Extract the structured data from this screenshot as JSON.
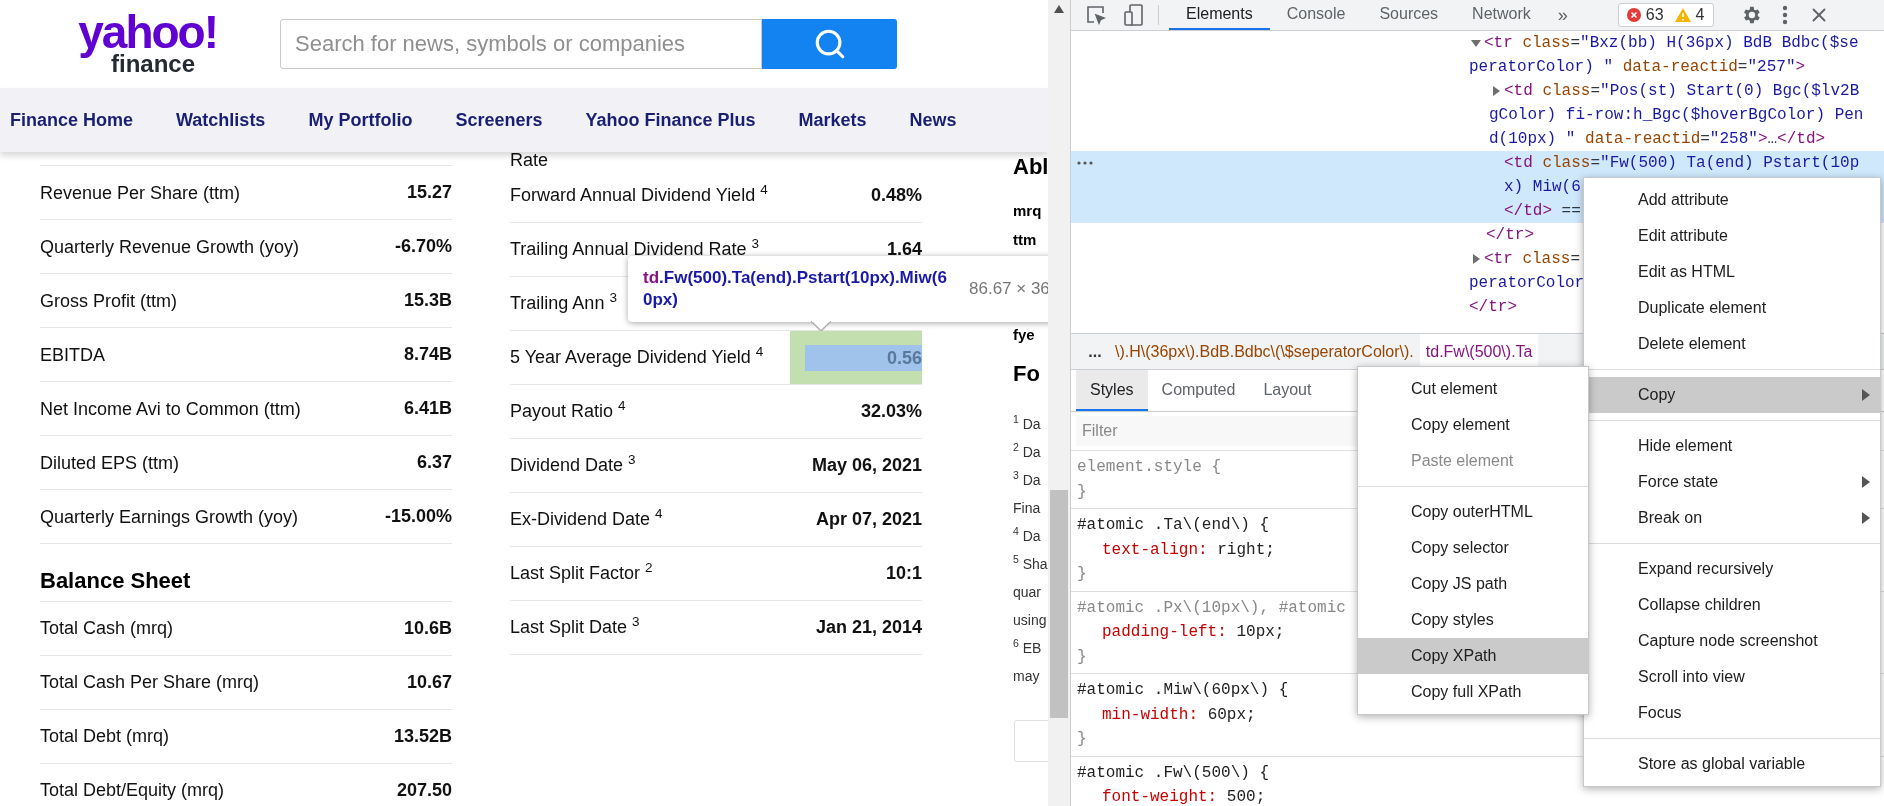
{
  "page": {
    "logo": {
      "brand": "yahoo!",
      "product": "finance"
    },
    "search": {
      "placeholder": "Search for news, symbols or companies"
    },
    "nav": [
      "Finance Home",
      "Watchlists",
      "My Portfolio",
      "Screeners",
      "Yahoo Finance Plus",
      "Markets",
      "News"
    ],
    "left_table": {
      "rows_top": [
        {
          "label": "Revenue Per Share (ttm)",
          "value": "15.27"
        },
        {
          "label": "Quarterly Revenue Growth (yoy)",
          "value": "-6.70%"
        },
        {
          "label": "Gross Profit (ttm)",
          "value": "15.3B"
        },
        {
          "label": "EBITDA",
          "value": "8.74B"
        },
        {
          "label": "Net Income Avi to Common (ttm)",
          "value": "6.41B"
        },
        {
          "label": "Diluted EPS (ttm)",
          "value": "6.37"
        },
        {
          "label": "Quarterly Earnings Growth (yoy)",
          "value": "-15.00%"
        }
      ],
      "section_title": "Balance Sheet",
      "rows_bottom": [
        {
          "label": "Total Cash (mrq)",
          "value": "10.6B"
        },
        {
          "label": "Total Cash Per Share (mrq)",
          "value": "10.67"
        },
        {
          "label": "Total Debt (mrq)",
          "value": "13.52B"
        },
        {
          "label": "Total Debt/Equity (mrq)",
          "value": "207.50"
        }
      ]
    },
    "middle_table": {
      "cut_label": "Rate",
      "rows": [
        {
          "label": "Forward Annual Dividend Yield $^{4}$",
          "value": "0.48%"
        },
        {
          "label": "Trailing Annual Dividend Rate $^{3}$",
          "value": "1.64"
        },
        {
          "label": "Trailing Ann $^{3}$"
        },
        {
          "label": "5 Year Average Dividend Yield $^{4}$",
          "value": "0.56",
          "highlighted": true
        },
        {
          "label": "Payout Ratio $^{4}$",
          "value": "32.03%"
        },
        {
          "label": "Dividend Date $^{3}$",
          "value": "May 06, 2021"
        },
        {
          "label": "Ex-Dividend Date $^{4}$",
          "value": "Apr 07, 2021"
        },
        {
          "label": "Last Split Factor $^{2}$",
          "value": "10:1"
        },
        {
          "label": "Last Split Date $^{3}$",
          "value": "Jan 21, 2014"
        }
      ]
    },
    "right_column": {
      "heading": "Abl",
      "terms": [
        "mrq",
        "ttm",
        "fye"
      ],
      "heading_2": "Fo",
      "footnotes": [
        "$^{1}$ Da",
        "$^{2}$ Da",
        "$^{3}$ Da",
        "Fina",
        "$^{4}$ Da",
        "$^{5}$ Sha",
        "quar",
        "using",
        "$^{6}$ EB",
        "may"
      ]
    },
    "tooltip": {
      "tag": "td",
      "selector": ".Fw(500).Ta(end).Pstart(10px).Miw(60px)",
      "size": "86.67 × 36"
    }
  },
  "devtools": {
    "tabs": [
      {
        "label": "Elements",
        "selected": true
      },
      {
        "label": "Console",
        "selected": false
      },
      {
        "label": "Sources",
        "selected": false
      },
      {
        "label": "Network",
        "selected": false
      }
    ],
    "more_tabs": "»",
    "errors": "63",
    "warnings": "4",
    "tree": [
      {
        "expanded": true,
        "selected": false,
        "lines": [
          [
            {
              "kind": "tag",
              "text": "<tr"
            },
            {
              "kind": "attr",
              "text": " class"
            },
            {
              "kind": "punct",
              "text": "="
            },
            {
              "kind": "value",
              "text": "\"Bxz(bb) H(36px) BdB Bdbc($se"
            }
          ],
          [
            {
              "kind": "value",
              "text": "peratorColor) \""
            },
            {
              "kind": "attr",
              "text": " data-reactid"
            },
            {
              "kind": "punct",
              "text": "="
            },
            {
              "kind": "value",
              "text": "\"257\""
            },
            {
              "kind": "tag",
              "text": ">"
            }
          ]
        ],
        "children": [
          {
            "expanded": false,
            "selected": false,
            "lines": [
              [
                {
                  "kind": "tag",
                  "text": "<td"
                },
                {
                  "kind": "attr",
                  "text": " class"
                },
                {
                  "kind": "punct",
                  "text": "="
                },
                {
                  "kind": "value",
                  "text": "\"Pos(st) Start(0) Bgc($lv2B"
                }
              ],
              [
                {
                  "kind": "value",
                  "text": "gColor) fi-row:h_Bgc($hoverBgColor) Pen"
                }
              ],
              [
                {
                  "kind": "value",
                  "text": "d(10px) \""
                },
                {
                  "kind": "attr",
                  "text": " data-reactid"
                },
                {
                  "kind": "punct",
                  "text": "="
                },
                {
                  "kind": "value",
                  "text": "\"258\""
                },
                {
                  "kind": "tag",
                  "text": ">"
                },
                {
                  "kind": "punct",
                  "text": "…"
                },
                {
                  "kind": "tag",
                  "text": "</td>"
                }
              ]
            ]
          },
          {
            "selected": true,
            "lines": [
              [
                {
                  "kind": "tag",
                  "text": "<td"
                },
                {
                  "kind": "attr",
                  "text": " class"
                },
                {
                  "kind": "punct",
                  "text": "="
                },
                {
                  "kind": "value",
                  "text": "\"Fw(500) Ta(end) Pstart(10p"
                }
              ],
              [
                {
                  "kind": "value",
                  "text": "x) Miw(6"
                }
              ],
              [
                {
                  "kind": "tag",
                  "text": "</td>"
                },
                {
                  "kind": "punct",
                  "text": " =="
                }
              ]
            ]
          }
        ],
        "closing": "</tr>"
      },
      {
        "expanded": false,
        "selected": false,
        "lines": [
          [
            {
              "kind": "tag",
              "text": "<tr"
            },
            {
              "kind": "attr",
              "text": " class"
            },
            {
              "kind": "punct",
              "text": "="
            }
          ],
          [
            {
              "kind": "value",
              "text": "peratorColor"
            }
          ],
          [
            {
              "kind": "tag",
              "text": "</tr>"
            }
          ]
        ]
      }
    ],
    "breadcrumbs": [
      {
        "text": "\\).H\\(36px\\).BdB.Bdbc\\(\\$seperatorColor\\).",
        "selected": false
      },
      {
        "text": "td.Fw\\(500\\).Ta",
        "selected": true
      }
    ],
    "breadcrumb_more": "...",
    "style_tabs": [
      {
        "label": "Styles",
        "selected": true
      },
      {
        "label": "Computed",
        "selected": false
      },
      {
        "label": "Layout",
        "selected": false
      }
    ],
    "filter_placeholder": "Filter",
    "rules": [
      {
        "selector": "element.style {",
        "dimmed": true,
        "close": "}"
      },
      {
        "selector": "#atomic .Ta\\(end\\) {",
        "dimmed": false,
        "declarations": [
          {
            "property": "text-align:",
            "value": "right;"
          }
        ],
        "close": "}"
      },
      {
        "selector": "#atomic .Px\\(10px\\), #atomic",
        "dimmed": true,
        "declarations": [
          {
            "property": "padding-left:",
            "value": "10px;"
          }
        ],
        "close": "}"
      },
      {
        "selector": "#atomic .Miw\\(60px\\) {",
        "dimmed": false,
        "declarations": [
          {
            "property": "min-width:",
            "value": "60px;"
          }
        ],
        "close": "}"
      },
      {
        "selector": "#atomic .Fw\\(500\\) {",
        "dimmed": false,
        "declarations": [
          {
            "property": "font-weight:",
            "value": "500;"
          }
        ]
      }
    ],
    "context_menu": [
      {
        "kind": "item",
        "label": "Add attribute",
        "highlighted": false,
        "has_submenu": false
      },
      {
        "kind": "item",
        "label": "Edit attribute",
        "highlighted": false,
        "has_submenu": false
      },
      {
        "kind": "item",
        "label": "Edit as HTML",
        "highlighted": false,
        "has_submenu": false
      },
      {
        "kind": "item",
        "label": "Duplicate element",
        "highlighted": false,
        "has_submenu": false
      },
      {
        "kind": "item",
        "label": "Delete element",
        "highlighted": false,
        "has_submenu": false
      },
      {
        "kind": "separator"
      },
      {
        "kind": "item",
        "label": "Copy",
        "highlighted": true,
        "has_submenu": true
      },
      {
        "kind": "separator"
      },
      {
        "kind": "item",
        "label": "Hide element",
        "highlighted": false,
        "has_submenu": false
      },
      {
        "kind": "item",
        "label": "Force state",
        "highlighted": false,
        "has_submenu": true
      },
      {
        "kind": "item",
        "label": "Break on",
        "highlighted": false,
        "has_submenu": true
      },
      {
        "kind": "separator"
      },
      {
        "kind": "item",
        "label": "Expand recursively",
        "highlighted": false,
        "has_submenu": false
      },
      {
        "kind": "item",
        "label": "Collapse children",
        "highlighted": false,
        "has_submenu": false
      },
      {
        "kind": "item",
        "label": "Capture node screenshot",
        "highlighted": false,
        "has_submenu": false
      },
      {
        "kind": "item",
        "label": "Scroll into view",
        "highlighted": false,
        "has_submenu": false
      },
      {
        "kind": "item",
        "label": "Focus",
        "highlighted": false,
        "has_submenu": false
      },
      {
        "kind": "separator"
      },
      {
        "kind": "item",
        "label": "Store as global variable",
        "highlighted": false,
        "has_submenu": false
      }
    ],
    "copy_submenu": [
      {
        "kind": "item",
        "label": "Cut element",
        "highlighted": false,
        "disabled": false
      },
      {
        "kind": "item",
        "label": "Copy element",
        "highlighted": false,
        "disabled": false
      },
      {
        "kind": "item",
        "label": "Paste element",
        "highlighted": false,
        "disabled": true
      },
      {
        "kind": "separator"
      },
      {
        "kind": "item",
        "label": "Copy outerHTML",
        "highlighted": false,
        "disabled": false
      },
      {
        "kind": "item",
        "label": "Copy selector",
        "highlighted": false,
        "disabled": false
      },
      {
        "kind": "item",
        "label": "Copy JS path",
        "highlighted": false,
        "disabled": false
      },
      {
        "kind": "item",
        "label": "Copy styles",
        "highlighted": false,
        "disabled": false
      },
      {
        "kind": "item",
        "label": "Copy XPath",
        "highlighted": true,
        "disabled": false
      },
      {
        "kind": "item",
        "label": "Copy full XPath",
        "highlighted": false,
        "disabled": false
      }
    ]
  }
}
